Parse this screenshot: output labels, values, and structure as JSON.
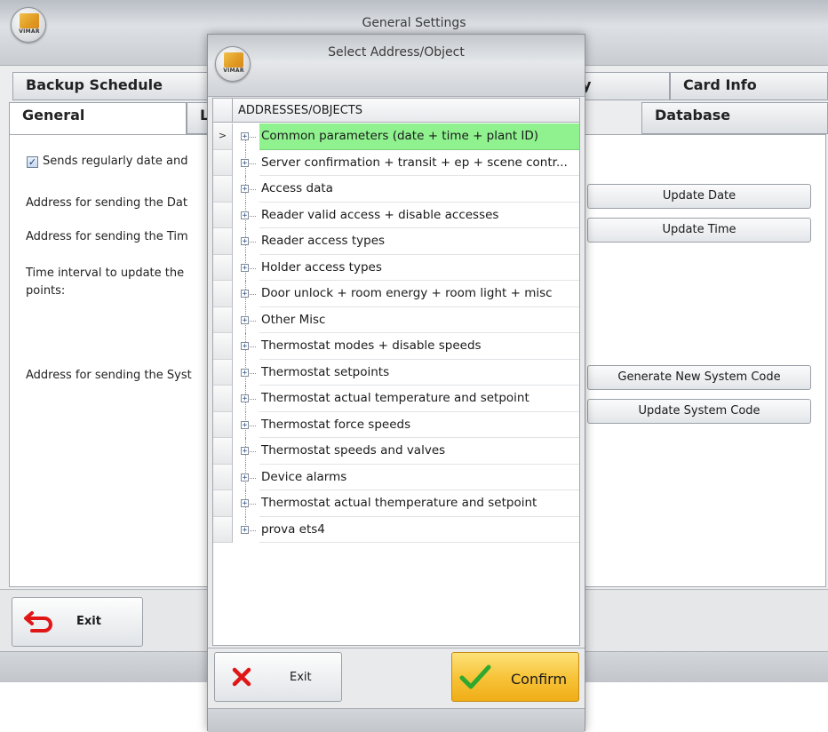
{
  "main_window": {
    "title": "General Settings",
    "logo_text": "VIMAR",
    "tabs_row1": [
      {
        "label": "Backup Schedule"
      },
      {
        "label": "y"
      },
      {
        "label": "Card Info"
      }
    ],
    "tabs_row2": [
      {
        "label": "General"
      },
      {
        "label": "L"
      },
      {
        "label": "Database"
      }
    ],
    "checkbox_label": "Sends regularly date and",
    "checkbox_mark": "✓",
    "label_date_address": "Address for sending the Dat",
    "label_time_address": "Address for sending the Tim",
    "label_interval_line1": "Time interval to update the",
    "label_interval_line2": "points:",
    "label_system_address": "Address for sending the Syst",
    "buttons": {
      "update_date": "Update Date",
      "update_time": "Update Time",
      "generate_new_system_code": "Generate New System Code",
      "update_system_code": "Update System Code"
    },
    "exit_label": "Exit"
  },
  "dialog": {
    "title": "Select Address/Object",
    "logo_text": "VIMAR",
    "column_header": "ADDRESSES/OBJECTS",
    "row_indicator": ">",
    "expander_glyph": "+",
    "rows": [
      {
        "label": "Common parameters (date + time + plant ID)",
        "selected": true
      },
      {
        "label": "Server confirmation + transit + ep + scene contr..."
      },
      {
        "label": "Access data"
      },
      {
        "label": "Reader valid access + disable accesses"
      },
      {
        "label": "Reader access types"
      },
      {
        "label": "Holder access types"
      },
      {
        "label": "Door unlock + room energy + room light + misc"
      },
      {
        "label": "Other Misc"
      },
      {
        "label": "Thermostat modes + disable speeds"
      },
      {
        "label": "Thermostat setpoints"
      },
      {
        "label": "Thermostat actual temperature and setpoint"
      },
      {
        "label": "Thermostat force speeds"
      },
      {
        "label": "Thermostat speeds and valves"
      },
      {
        "label": "Device alarms"
      },
      {
        "label": "Thermostat actual themperature and setpoint"
      },
      {
        "label": "prova ets4"
      }
    ],
    "exit_label": "Exit",
    "confirm_label": "Confirm"
  },
  "colors": {
    "selected_row": "#8ff28f",
    "confirm_button": "#f7c43a",
    "exit_icon_red": "#e01616",
    "confirm_check_green": "#2ea82e"
  }
}
